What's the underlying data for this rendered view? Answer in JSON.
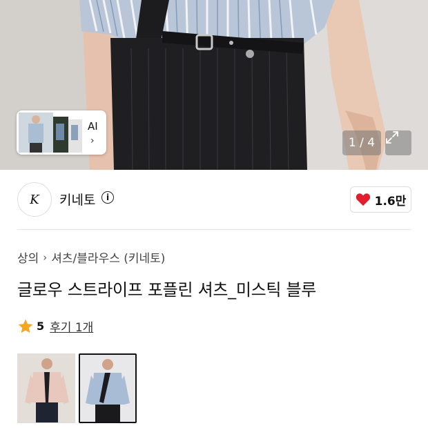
{
  "gallery": {
    "counter": "1 / 4",
    "ai_chip": {
      "label": "AI",
      "chevron": "›"
    },
    "expand_icon": "expand-icon"
  },
  "brand": {
    "logo_text": "K",
    "name": "키네토",
    "info_icon": "i"
  },
  "likes": {
    "count": "1.6만",
    "icon": "heart-icon",
    "color": "#e11d2e"
  },
  "breadcrumb": {
    "items": [
      "상의",
      "셔츠/블라우스 (키네토)"
    ],
    "separator": "›"
  },
  "product": {
    "title": "글로우 스트라이프 포플린 셔츠_미스틱 블루"
  },
  "rating": {
    "score": "5",
    "reviews": "후기 1개",
    "star_color": "#f5a623"
  },
  "options": {
    "items": [
      {
        "name": "beige",
        "selected": false
      },
      {
        "name": "blue",
        "selected": true
      }
    ]
  }
}
